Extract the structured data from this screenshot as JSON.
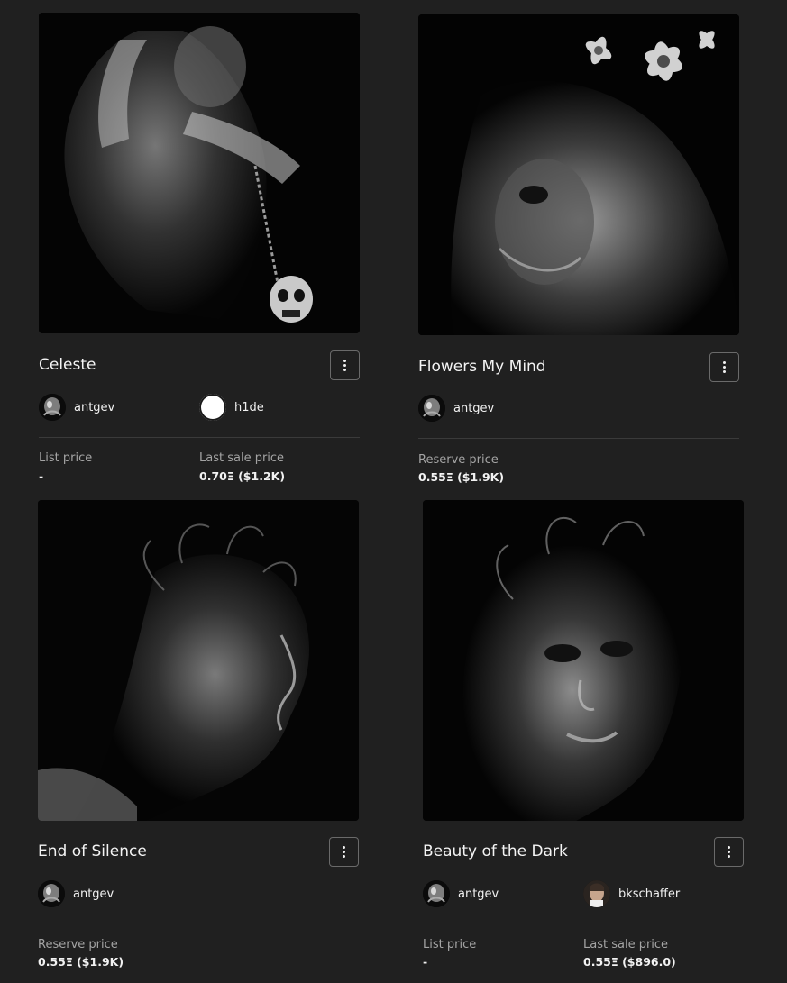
{
  "cards": [
    {
      "title": "Celeste",
      "creator": {
        "name": "antgev",
        "avatar": "artist-avatar"
      },
      "owner": {
        "name": "h1de",
        "avatar": "white-circle-avatar"
      },
      "price_label_1": "List price",
      "price_value_1": "-",
      "price_label_2": "Last sale price",
      "price_value_2": "0.70Ξ ($1.2K)",
      "artwork": "winged-figure-holding-skull-chain"
    },
    {
      "title": "Flowers My Mind",
      "creator": {
        "name": "antgev",
        "avatar": "artist-avatar"
      },
      "price_label_1": "Reserve price",
      "price_value_1": "0.55Ξ ($1.9K)",
      "artwork": "dissolving-face-with-flowers"
    },
    {
      "title": "End of Silence",
      "creator": {
        "name": "antgev",
        "avatar": "artist-avatar"
      },
      "price_label_1": "Reserve price",
      "price_value_1": "0.55Ξ ($1.9K)",
      "artwork": "dark-profile-with-tendrils"
    },
    {
      "title": "Beauty of the Dark",
      "creator": {
        "name": "antgev",
        "avatar": "artist-avatar"
      },
      "owner": {
        "name": "bkschaffer",
        "avatar": "photo-avatar"
      },
      "price_label_1": "List price",
      "price_value_1": "-",
      "price_label_2": "Last sale price",
      "price_value_2": "0.55Ξ ($896.0)",
      "artwork": "shattered-face-portrait"
    }
  ],
  "theme": {
    "background": "#202020",
    "text": "#f2f2f2",
    "muted": "#a4a4a4",
    "divider": "#3a3a3a"
  }
}
